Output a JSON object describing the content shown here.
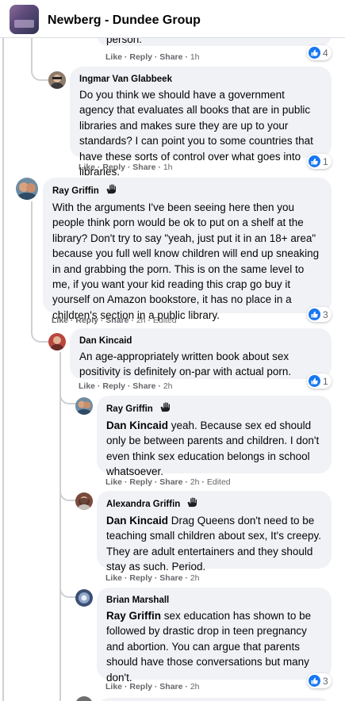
{
  "group": {
    "title": "Newberg - Dundee Group"
  },
  "colors": {
    "like_blue": "#1877f2",
    "bubble": "#f0f2f5",
    "meta_gray": "#65676b"
  },
  "comments": [
    {
      "text_partial": "person.",
      "actions": {
        "like": "Like",
        "reply": "Reply",
        "share": "Share",
        "time": "1h"
      },
      "reactions": "4"
    },
    {
      "author": "Ingmar Van Glabbeek",
      "text": "Do you think we should have a government agency that evaluates all books that are in public libraries and makes sure they are up to your standards? I can point you to some countries that have these sorts of control over what goes into libraries.",
      "actions": {
        "like": "Like",
        "reply": "Reply",
        "share": "Share",
        "time": "1h"
      },
      "reactions": "1"
    },
    {
      "author": "Ray Griffin",
      "text": "With the arguments I've been seeing here then you people think porn would be ok to put on a shelf at the library? Don't try to say \"yeah, just put it in an 18+ area\" because you full well know children will end up sneaking in and grabbing the porn. This is on the same level to me, if you want your kid reading this crap go buy it yourself on Amazon bookstore, it has no place in a children's section in a public library.",
      "actions": {
        "like": "Like",
        "reply": "Reply",
        "share": "Share",
        "time": "2h",
        "edited": "Edited"
      },
      "reactions": "3"
    },
    {
      "author": "Dan Kincaid",
      "text": "An age-appropriately written book about sex positivity is definitely on-par with actual porn.",
      "actions": {
        "like": "Like",
        "reply": "Reply",
        "share": "Share",
        "time": "2h"
      },
      "reactions": "1"
    },
    {
      "author": "Ray Griffin",
      "mention": "Dan Kincaid",
      "text": " yeah. Because sex ed should only be between parents and children. I don't even think sex education belongs in school whatsoever.",
      "actions": {
        "like": "Like",
        "reply": "Reply",
        "share": "Share",
        "time": "2h",
        "edited": "Edited"
      }
    },
    {
      "author": "Alexandra Griffin",
      "mention": "Dan Kincaid",
      "text": " Drag Queens don't need to be teaching small children about sex, It's creepy. They are adult entertainers and they should stay as such. Period.",
      "actions": {
        "like": "Like",
        "reply": "Reply",
        "share": "Share",
        "time": "2h"
      }
    },
    {
      "author": "Brian Marshall",
      "mention": "Ray Griffin",
      "text": " sex education has shown to be followed by drastic drop in teen pregnancy and abortion. You can argue that parents should have those conversations but many don't.",
      "actions": {
        "like": "Like",
        "reply": "Reply",
        "share": "Share",
        "time": "2h"
      },
      "reactions": "3"
    }
  ]
}
